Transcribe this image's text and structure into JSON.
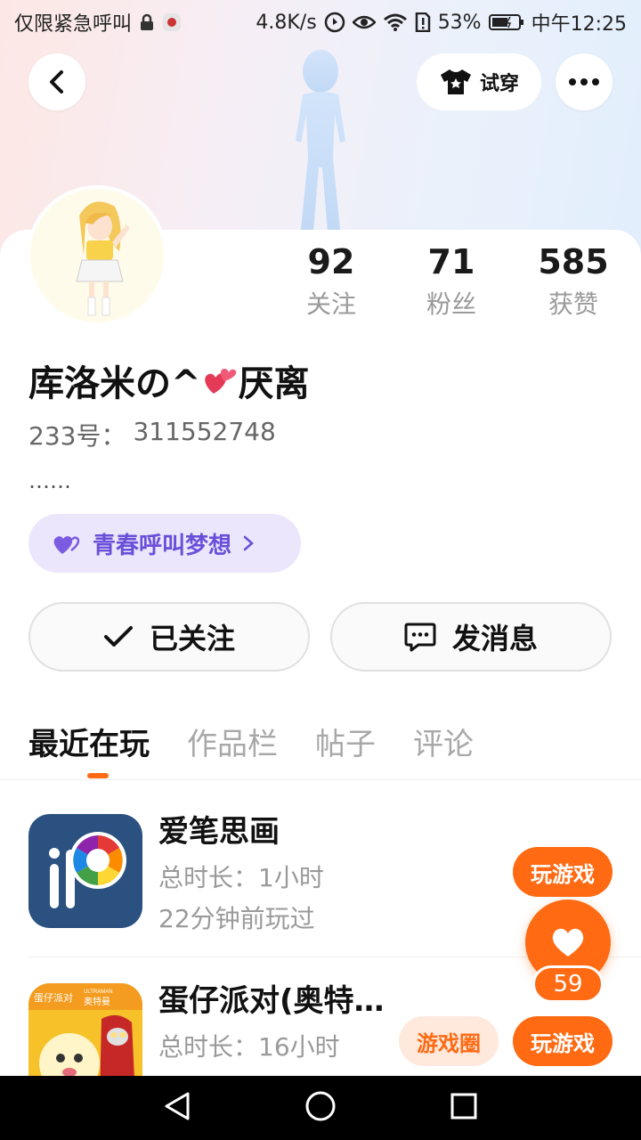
{
  "status_bar": {
    "carrier": "仅限紧急呼叫",
    "speed": "4.8K/s",
    "battery": "53%",
    "time": "中午12:25"
  },
  "header": {
    "tryon_label": "试穿"
  },
  "profile": {
    "stats": [
      {
        "value": "92",
        "label": "关注"
      },
      {
        "value": "71",
        "label": "粉丝"
      },
      {
        "value": "585",
        "label": "获赞"
      }
    ],
    "name_prefix": "库洛米の^",
    "name_suffix": "厌离",
    "id_label": "233号：",
    "id_value": "311552748",
    "bio": "……",
    "tag": "青春呼叫梦想"
  },
  "actions": {
    "follow_label": "已关注",
    "message_label": "发消息"
  },
  "tabs": [
    "最近在玩",
    "作品栏",
    "帖子",
    "评论"
  ],
  "games": [
    {
      "name": "爱笔思画",
      "duration": "总时长：1小时",
      "last_played": "22分钟前玩过",
      "play_label": "玩游戏"
    },
    {
      "name": "蛋仔派对(奥特…",
      "duration": "总时长：16小时",
      "circle_label": "游戏圈",
      "play_label": "玩游戏",
      "icon_badge_left": "蛋仔派对",
      "icon_badge_right_top": "ULTRAMAN",
      "icon_badge_right": "奥特曼"
    }
  ],
  "like": {
    "count": "59"
  },
  "colors": {
    "accent": "#ff6a13",
    "tag_text": "#6a4fd8",
    "tag_bg": "#ebe6fb"
  }
}
